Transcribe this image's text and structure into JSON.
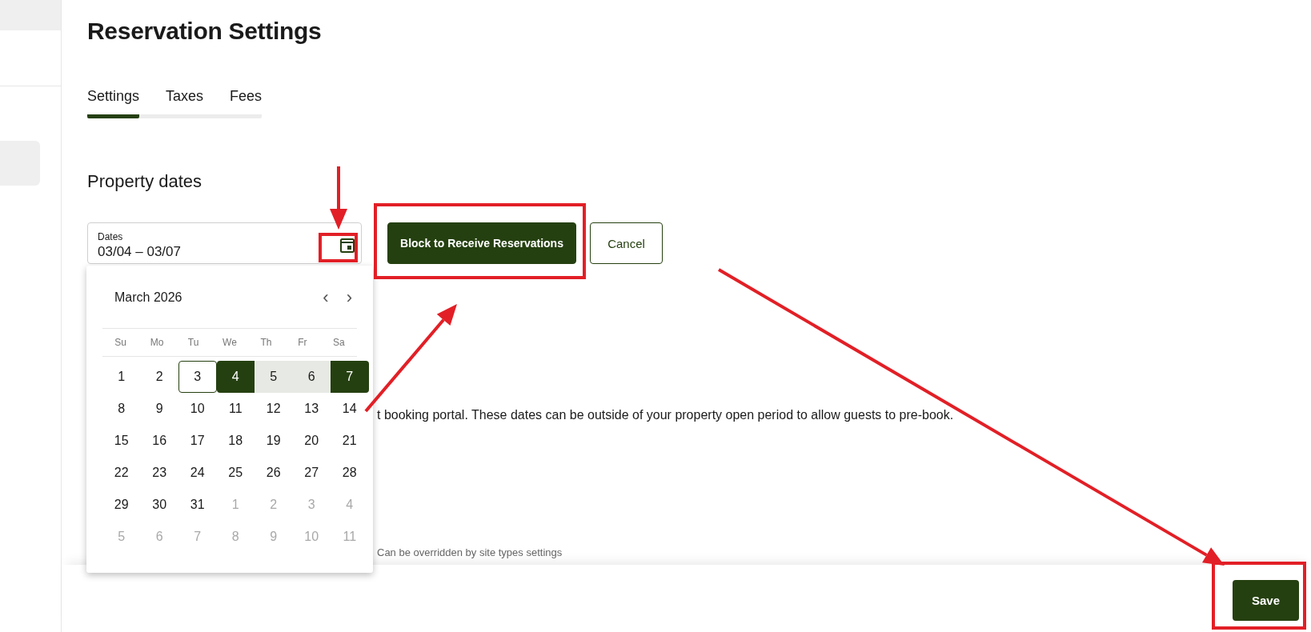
{
  "page": {
    "title": "Reservation Settings"
  },
  "tabs": [
    {
      "label": "Settings",
      "selected": true
    },
    {
      "label": "Taxes",
      "selected": false
    },
    {
      "label": "Fees",
      "selected": false
    }
  ],
  "section": {
    "heading": "Property dates"
  },
  "date_field": {
    "label": "Dates",
    "value": "03/04 – 03/07"
  },
  "buttons": [
    {
      "label": "Block to Receive Reservations",
      "kind": "primary"
    },
    {
      "label": "Cancel",
      "kind": "outline"
    }
  ],
  "calendar": {
    "month": "March 2026",
    "prev": "‹",
    "next": "›",
    "weekdays": [
      "Su",
      "Mo",
      "Tu",
      "We",
      "Th",
      "Fr",
      "Sa"
    ],
    "days": [
      {
        "label": "1",
        "kind": "normal"
      },
      {
        "label": "2",
        "kind": "normal"
      },
      {
        "label": "3",
        "kind": "today"
      },
      {
        "label": "4",
        "kind": "start"
      },
      {
        "label": "5",
        "kind": "range"
      },
      {
        "label": "6",
        "kind": "range"
      },
      {
        "label": "7",
        "kind": "end"
      },
      {
        "label": "8",
        "kind": "normal"
      },
      {
        "label": "9",
        "kind": "normal"
      },
      {
        "label": "10",
        "kind": "normal"
      },
      {
        "label": "11",
        "kind": "normal"
      },
      {
        "label": "12",
        "kind": "normal"
      },
      {
        "label": "13",
        "kind": "normal"
      },
      {
        "label": "14",
        "kind": "normal"
      },
      {
        "label": "15",
        "kind": "normal"
      },
      {
        "label": "16",
        "kind": "normal"
      },
      {
        "label": "17",
        "kind": "normal"
      },
      {
        "label": "18",
        "kind": "normal"
      },
      {
        "label": "19",
        "kind": "normal"
      },
      {
        "label": "20",
        "kind": "normal"
      },
      {
        "label": "21",
        "kind": "normal"
      },
      {
        "label": "22",
        "kind": "normal"
      },
      {
        "label": "23",
        "kind": "normal"
      },
      {
        "label": "24",
        "kind": "normal"
      },
      {
        "label": "25",
        "kind": "normal"
      },
      {
        "label": "26",
        "kind": "normal"
      },
      {
        "label": "27",
        "kind": "normal"
      },
      {
        "label": "28",
        "kind": "normal"
      },
      {
        "label": "29",
        "kind": "normal"
      },
      {
        "label": "30",
        "kind": "normal"
      },
      {
        "label": "31",
        "kind": "normal"
      },
      {
        "label": "1",
        "kind": "outside"
      },
      {
        "label": "2",
        "kind": "outside"
      },
      {
        "label": "3",
        "kind": "outside"
      },
      {
        "label": "4",
        "kind": "outside"
      },
      {
        "label": "5",
        "kind": "outside"
      },
      {
        "label": "6",
        "kind": "outside"
      },
      {
        "label": "7",
        "kind": "outside"
      },
      {
        "label": "8",
        "kind": "outside"
      },
      {
        "label": "9",
        "kind": "outside"
      },
      {
        "label": "10",
        "kind": "outside"
      },
      {
        "label": "11",
        "kind": "outside"
      }
    ]
  },
  "description": "t booking portal. These dates can be outside of your property open period to allow guests to pre-book.",
  "hint": "Can be overridden by site types settings",
  "footer": {
    "save": "Save"
  }
}
